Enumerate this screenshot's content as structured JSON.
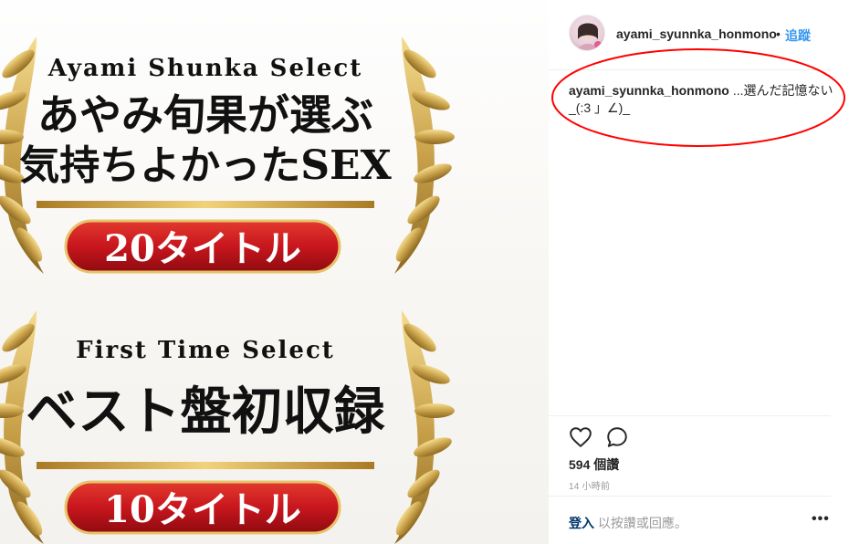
{
  "post_image": {
    "top_block": {
      "english_title": "Ayami Shunka Select",
      "line1": "あやみ旬果が選ぶ",
      "line2": "気持ちよかったSEX",
      "badge": "20タイトル"
    },
    "bottom_block": {
      "english_title": "First Time Select",
      "line1": "ベスト盤初収録",
      "badge": "10タイトル"
    },
    "colors": {
      "gold": "#c9a14a",
      "badge_red": "#c8161d",
      "text": "#111111"
    }
  },
  "header": {
    "username": "ayami_syunnka_honmono",
    "dot": "•",
    "follow_label": "追蹤"
  },
  "caption": {
    "username": "ayami_syunnka_honmono",
    "text": "...選んだ記憶ない_(:3 」∠)_",
    "highlight_color": "#ff0000"
  },
  "actions": {
    "like_icon": "heart-icon",
    "comment_icon": "comment-icon"
  },
  "likes": "594 個讚",
  "timestamp": "14 小時前",
  "footer": {
    "login_label": "登入",
    "rest_text": "以按讚或回應。",
    "more_label": "•••"
  }
}
